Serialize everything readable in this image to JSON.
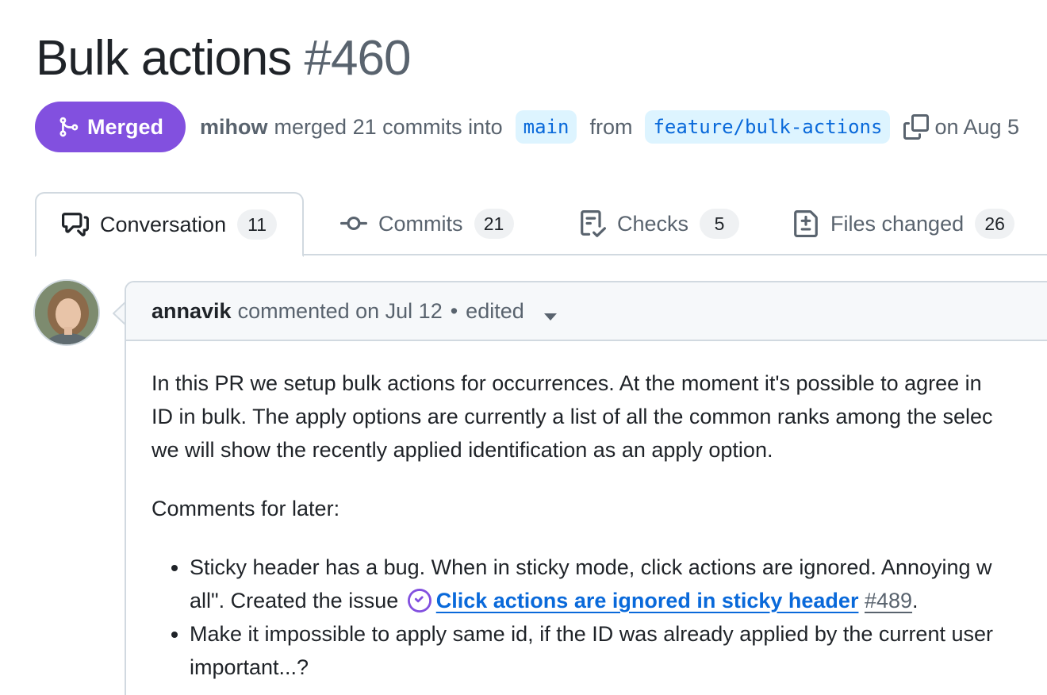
{
  "pr": {
    "title": "Bulk actions",
    "number": "#460",
    "state_label": "Merged",
    "author": "mihow",
    "merge_text": "merged 21 commits into",
    "base_branch": "main",
    "from_text": "from",
    "head_branch": "feature/bulk-actions",
    "date_text": "on Aug 5"
  },
  "tabs": [
    {
      "label": "Conversation",
      "count": "11",
      "icon": "comment-discussion-icon",
      "active": true
    },
    {
      "label": "Commits",
      "count": "21",
      "icon": "git-commit-icon",
      "active": false
    },
    {
      "label": "Checks",
      "count": "5",
      "icon": "checklist-icon",
      "active": false
    },
    {
      "label": "Files changed",
      "count": "26",
      "icon": "file-diff-icon",
      "active": false
    }
  ],
  "comment": {
    "author": "annavik",
    "meta": "commented on Jul 12",
    "separator": "•",
    "edited": "edited",
    "body": {
      "para1_line1": "In this PR we setup bulk actions for occurrences. At the moment it's possible to agree in",
      "para1_line2": "ID in bulk. The apply options are currently a list of all the common ranks among the selec",
      "para1_line3": "we will show the recently applied identification as an apply option.",
      "para2": "Comments for later:",
      "item1_line1": "Sticky header has a bug. When in sticky mode, click actions are ignored. Annoying w",
      "item1_line2_prefix": "all\". Created the issue",
      "item1_link_title": "Click actions are ignored in sticky header",
      "item1_link_number": "#489",
      "item1_suffix": ".",
      "item2_line1": "Make it impossible to apply same id, if the ID was already applied by the current user",
      "item2_line2": "important...?"
    }
  },
  "colors": {
    "merged": "#8250df",
    "link": "#0969da",
    "muted": "#59636e",
    "branch_bg": "#ddf4ff"
  }
}
